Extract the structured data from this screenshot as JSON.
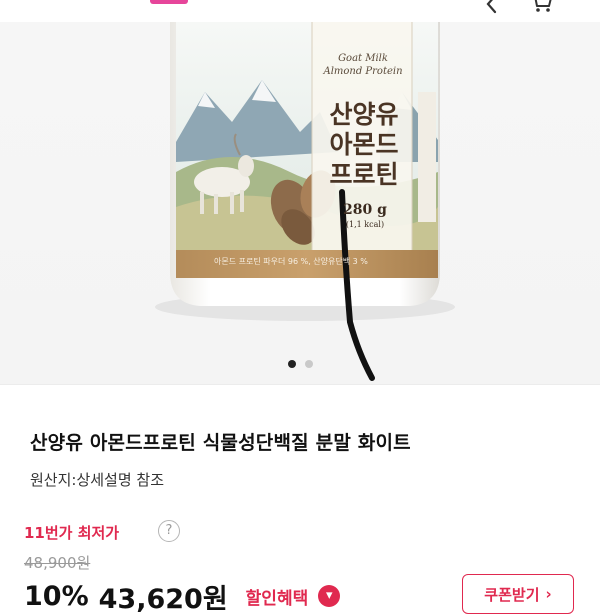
{
  "header": {
    "back_icon": "chevron-left-icon",
    "cart_icon": "cart-icon",
    "accent_color": "#e6459a"
  },
  "product_image": {
    "package_label_en": "Goat Milk\nAlmond Protein",
    "package_label_ko": "산양유\n아몬드\n프로틴",
    "package_weight": "280 g",
    "package_kcal": "(1,1   kcal)",
    "package_ingredient": "아몬드 프로틴 파우더 96 %, 산양유단백 3 %",
    "pager_total": 2,
    "pager_active": 1
  },
  "product": {
    "title": "산양유 아몬드프로틴 식물성단백질 분말 화이트",
    "origin": "원산지:상세설명 참조",
    "lowest_price_label": "11번가 최저가",
    "help_icon": "question-icon",
    "original_price": "48,900원",
    "discount_rate": "10%",
    "sale_price": "43,620원",
    "benefit_label": "할인혜택",
    "benefit_icon": "chevron-down-icon",
    "coupon_button": "쿠폰받기",
    "coupon_icon": "chevron-right-icon",
    "brand_color": "#e0294f"
  }
}
